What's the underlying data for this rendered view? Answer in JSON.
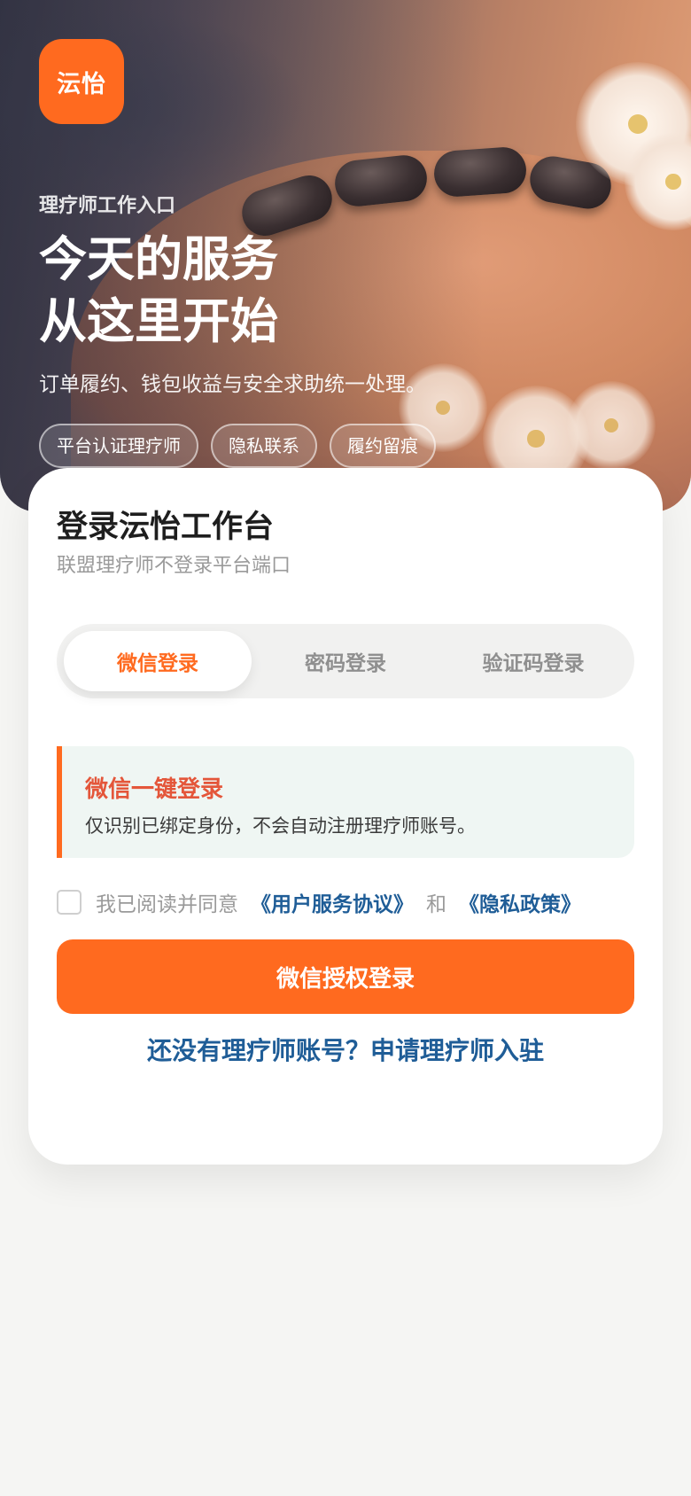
{
  "hero": {
    "logo_text": "沄怡",
    "eyebrow": "理疗师工作入口",
    "headline_line1": "今天的服务",
    "headline_line2": "从这里开始",
    "subtitle": "订单履约、钱包收益与安全求助统一处理。",
    "tags": [
      "平台认证理疗师",
      "隐私联系",
      "履约留痕"
    ]
  },
  "login": {
    "title": "登录沄怡工作台",
    "subtitle": "联盟理疗师不登录平台端口",
    "tabs": [
      {
        "label": "微信登录",
        "active": true
      },
      {
        "label": "密码登录",
        "active": false
      },
      {
        "label": "验证码登录",
        "active": false
      }
    ],
    "notice": {
      "title": "微信一键登录",
      "text": "仅识别已绑定身份，不会自动注册理疗师账号。"
    },
    "agreement": {
      "checked": false,
      "prefix": "我已阅读并同意",
      "terms_link": "《用户服务协议》",
      "joiner": "和",
      "privacy_link": "《隐私政策》"
    },
    "primary_button": "微信授权登录",
    "apply_link": "还没有理疗师账号？申请理疗师入驻"
  },
  "colors": {
    "accent": "#ff6a1f",
    "link": "#1f5d97",
    "notice_title": "#e4563a",
    "notice_bg": "#eff6f3",
    "page_bg": "#f5f5f3"
  }
}
